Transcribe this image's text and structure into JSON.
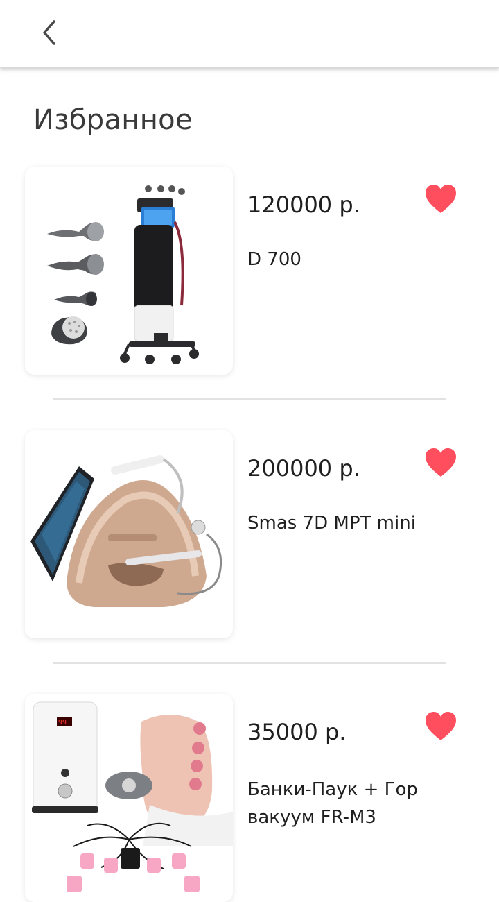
{
  "header": {
    "back_icon": "chevron-left-icon"
  },
  "page": {
    "title": "Избранное"
  },
  "colors": {
    "heart": "#ff4f5e",
    "divider": "#e2e2e2",
    "text": "#1f1f1f"
  },
  "favorites": [
    {
      "price": "120000 р.",
      "name": "D 700",
      "favorite_icon": "heart-icon"
    },
    {
      "price": "200000 р.",
      "name": "Smas 7D MPT mini",
      "favorite_icon": "heart-icon"
    },
    {
      "price": "35000 р.",
      "name": "Банки-Паук + Гор вакуум FR-M3",
      "favorite_icon": "heart-icon"
    }
  ]
}
